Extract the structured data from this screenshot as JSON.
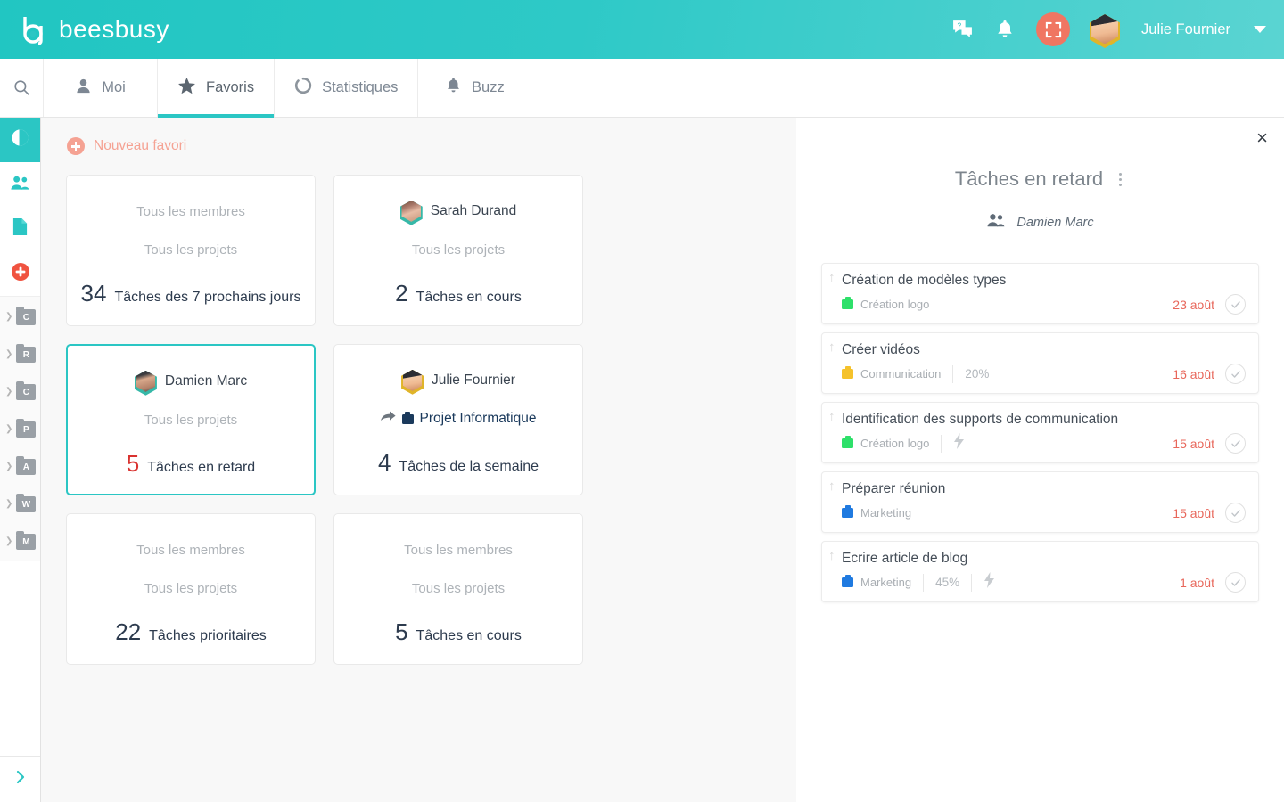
{
  "brand": {
    "name": "beesbusy",
    "teal": "#2BC6C4",
    "coral": "#F07662",
    "salmon": "#F5A293"
  },
  "header": {
    "user_name": "Julie Fournier",
    "icons": [
      {
        "name": "messages-help-icon",
        "glyph": "?"
      },
      {
        "name": "notification-bell-icon",
        "glyph": "bell"
      },
      {
        "name": "fullscreen-icon",
        "glyph": "expand"
      }
    ]
  },
  "nav": {
    "search_label": "search",
    "tabs": [
      {
        "label": "Moi",
        "icon": "person-icon",
        "active": false
      },
      {
        "label": "Favoris",
        "icon": "star-icon",
        "active": true
      },
      {
        "label": "Statistiques",
        "icon": "donut-chart-icon",
        "active": false
      },
      {
        "label": "Buzz",
        "icon": "bell-icon",
        "active": false
      }
    ]
  },
  "rail": {
    "top_items": [
      {
        "name": "dashboard-icon",
        "selected": true
      },
      {
        "name": "team-members-icon",
        "selected": false
      },
      {
        "name": "document-icon",
        "selected": false
      },
      {
        "name": "add-project-icon",
        "selected": false
      }
    ],
    "projects": [
      {
        "letter": "C"
      },
      {
        "letter": "R"
      },
      {
        "letter": "C"
      },
      {
        "letter": "P"
      },
      {
        "letter": "A"
      },
      {
        "letter": "W"
      },
      {
        "letter": "M"
      }
    ],
    "expand_label": "expand-sidebar"
  },
  "main": {
    "new_favorite_label": "Nouveau favori",
    "cards": [
      {
        "scope": "Tous les membres",
        "scope_icon": "none",
        "project": "Tous les projets",
        "project_icon": "none",
        "count": "34",
        "label": "Tâches des 7 prochains jours",
        "count_color": "dark",
        "selected": false
      },
      {
        "scope": "Sarah Durand",
        "scope_icon": "avatar",
        "project": "Tous les projets",
        "project_icon": "none",
        "count": "2",
        "label": "Tâches en cours",
        "count_color": "dark",
        "selected": false
      },
      {
        "scope": "Damien Marc",
        "scope_icon": "avatar",
        "project": "Tous les projets",
        "project_icon": "none",
        "count": "5",
        "label": "Tâches en retard",
        "count_color": "red",
        "selected": true
      },
      {
        "scope": "Julie Fournier",
        "scope_icon": "avatar",
        "project": "Projet Informatique",
        "project_icon": "share-briefcase",
        "count": "4",
        "label": "Tâches de la semaine",
        "count_color": "dark",
        "selected": false
      },
      {
        "scope": "Tous les membres",
        "scope_icon": "none",
        "project": "Tous les projets",
        "project_icon": "none",
        "count": "22",
        "label": "Tâches prioritaires",
        "count_color": "dark",
        "selected": false
      },
      {
        "scope": "Tous les membres",
        "scope_icon": "none",
        "project": "Tous les projets",
        "project_icon": "none",
        "count": "5",
        "label": "Tâches en cours",
        "count_color": "dark",
        "selected": false
      }
    ]
  },
  "panel": {
    "close_label": "×",
    "title": "Tâches en retard",
    "member": "Damien Marc",
    "tasks": [
      {
        "title": "Création de modèles types",
        "project": "Création logo",
        "project_color": "#2ee06a",
        "percent": "",
        "priority": false,
        "date": "23 août"
      },
      {
        "title": "Créer vidéos",
        "project": "Communication",
        "project_color": "#f5c22b",
        "percent": "20%",
        "priority": false,
        "date": "16 août"
      },
      {
        "title": "Identification des supports de communication",
        "project": "Création logo",
        "project_color": "#2ee06a",
        "percent": "",
        "priority": true,
        "date": "15 août"
      },
      {
        "title": "Préparer réunion",
        "project": "Marketing",
        "project_color": "#1f7ae0",
        "percent": "",
        "priority": false,
        "date": "15 août"
      },
      {
        "title": "Ecrire article de blog",
        "project": "Marketing",
        "project_color": "#1f7ae0",
        "percent": "45%",
        "priority": true,
        "date": "1 août"
      }
    ]
  }
}
